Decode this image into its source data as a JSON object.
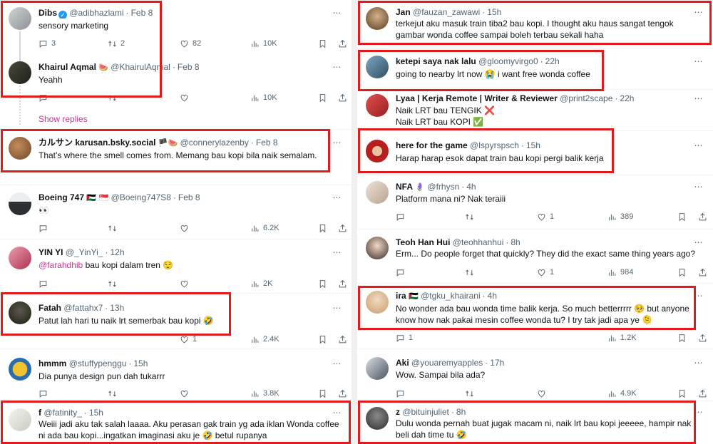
{
  "left": {
    "tweets": [
      {
        "name": "Dibs",
        "handle": "@adibhazlami",
        "time": "Feb 8",
        "text": "sensory marketing",
        "replies": "3",
        "retweets": "2",
        "likes": "82",
        "views": "10K"
      },
      {
        "name": "Khairul Aqmal",
        "name_emoji": "🍉",
        "handle": "@KhairulAqmal",
        "time": "Feb 8",
        "text": "Yeahh",
        "replies": "",
        "retweets": "",
        "likes": "",
        "views": "10K"
      },
      {
        "show_replies": "Show replies"
      },
      {
        "name": "カルサン karusan.bsky.social",
        "name_emoji": "🏴🍉",
        "handle": "@connerylazenby",
        "time": "Feb 8",
        "text": "That’s where the smell comes from. Memang bau kopi bila naik semalam."
      },
      {
        "name": "Boeing 747",
        "name_emoji": "🇵🇸 🇸🇬",
        "handle": "@Boeing747S8",
        "time": "Feb 8",
        "text": "👀",
        "replies": "",
        "retweets": "",
        "likes": "",
        "views": "6.2K"
      },
      {
        "name": "YIN YI",
        "handle": "@_YinYi_",
        "time": "12h",
        "mention": "@farahdhib",
        "text": " bau kopi dalam tren 😌",
        "views": "2K"
      },
      {
        "name": "Fatah",
        "handle": "@fattahx7",
        "time": "13h",
        "text": "Patut lah hari tu naik lrt semerbak bau kopi 🤣",
        "likes": "1",
        "views": "2.4K"
      },
      {
        "name": "hmmm",
        "handle": "@stuffypenggu",
        "time": "15h",
        "text": "Dia punya design pun dah tukarrr",
        "views": "3.8K"
      },
      {
        "name": "f",
        "handle": "@fatinity_",
        "time": "15h",
        "text": "Weiii jadi aku tak salah laaaa. Aku perasan gak train yg ada iklan Wonda coffee ni ada bau kopi...ingatkan imaginasi aku je 🤣 betul rupanya"
      }
    ]
  },
  "right": {
    "tweets": [
      {
        "name": "Jan",
        "handle": "@fauzan_zawawi",
        "time": "15h",
        "text": "terkejut aku masuk train tiba2 bau kopi. I thought aku haus sangat tengok gambar wonda coffee sampai boleh terbau sekali haha"
      },
      {
        "name": "ketepi saya nak lalu",
        "handle": "@gloomyvirgo0",
        "time": "22h",
        "text": "going to nearby lrt now 😭 i want free wonda coffee"
      },
      {
        "name": "Lyaa | Kerja Remote | Writer & Reviewer",
        "handle": "@print2scape",
        "time": "22h",
        "text": "Naik LRT bau TENGIK ❌",
        "text2": "Naik LRT bau KOPI ✅"
      },
      {
        "name": "here for the game",
        "handle": "@lspyrspsch",
        "time": "15h",
        "text": "Harap harap esok dapat train bau kopi pergi balik kerja"
      },
      {
        "name": "NFA",
        "name_emoji": "🪻",
        "handle": "@frhysn",
        "time": "4h",
        "text": "Platform mana ni? Nak teraiii",
        "likes": "1",
        "views": "389"
      },
      {
        "name": "Teoh Han Hui",
        "handle": "@teohhanhui",
        "time": "8h",
        "text": "Erm... Do people forget that quickly? They did the exact same thing years ago?",
        "likes": "1",
        "views": "984"
      },
      {
        "name": "ira",
        "name_emoji": "🇵🇸",
        "handle": "@tgku_khairani",
        "time": "4h",
        "text": "No wonder ada bau wonda time balik kerja. So much betterrrrr 🥺 but anyone know how nak pakai mesin coffee wonda tu? I try tak jadi apa ye 🫠",
        "replies": "1",
        "views": "1.2K"
      },
      {
        "name": "Aki",
        "handle": "@youaremyapples",
        "time": "17h",
        "text": "Wow. Sampai bila ada?",
        "views": "4.9K"
      },
      {
        "name": "z",
        "handle": "@bituinjuliet",
        "time": "8h",
        "text": "Dulu wonda pernah buat jugak macam ni, naik lrt bau kopi jeeeee, hampir nak beli dah time tu 🤣"
      }
    ]
  },
  "icons": {
    "more": "⋯",
    "verified": "✓"
  },
  "colors": {
    "highlight": "#e11b1b",
    "mention": "#c2368f",
    "verified": "#1d9bf0",
    "muted": "#536471"
  }
}
